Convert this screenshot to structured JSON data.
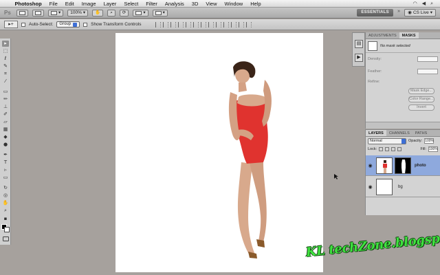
{
  "menubar": {
    "app_name": "Photoshop",
    "items": [
      "File",
      "Edit",
      "Image",
      "Layer",
      "Select",
      "Filter",
      "Analysis",
      "3D",
      "View",
      "Window",
      "Help"
    ]
  },
  "appbar": {
    "zoom": "100%",
    "workspace": "ESSENTIALS",
    "cs_live": "CS Live"
  },
  "options_bar": {
    "auto_select_label": "Auto-Select:",
    "auto_select_value": "Group",
    "transform_controls_label": "Show Transform Controls"
  },
  "adjustments_panel": {
    "tabs": [
      "ADJUSTMENTS",
      "MASKS"
    ],
    "active_tab": "MASKS",
    "message": "No mask selected",
    "density_label": "Density:",
    "feather_label": "Feather:",
    "refine_label": "Refine:",
    "mask_edge_button": "Mask Edge...",
    "color_range_button": "Color Range...",
    "invert_button": "Invert"
  },
  "layers_panel": {
    "tabs": [
      "LAYERS",
      "CHANNELS",
      "PATHS"
    ],
    "active_tab": "LAYERS",
    "blend_mode": "Normal",
    "opacity_label": "Opacity:",
    "opacity_value": "100%",
    "lock_label": "Lock:",
    "fill_label": "Fill:",
    "fill_value": "100%",
    "layers": [
      {
        "name": "photo",
        "selected": true
      },
      {
        "name": "bg",
        "selected": false
      }
    ]
  },
  "watermark": "KL techZone.blogspot.com",
  "colors": {
    "workspace_bg": "#a6a19d",
    "selection_blue": "#8ea9dd",
    "swimsuit_red": "#e0332f",
    "watermark_green": "#3fe23f"
  }
}
